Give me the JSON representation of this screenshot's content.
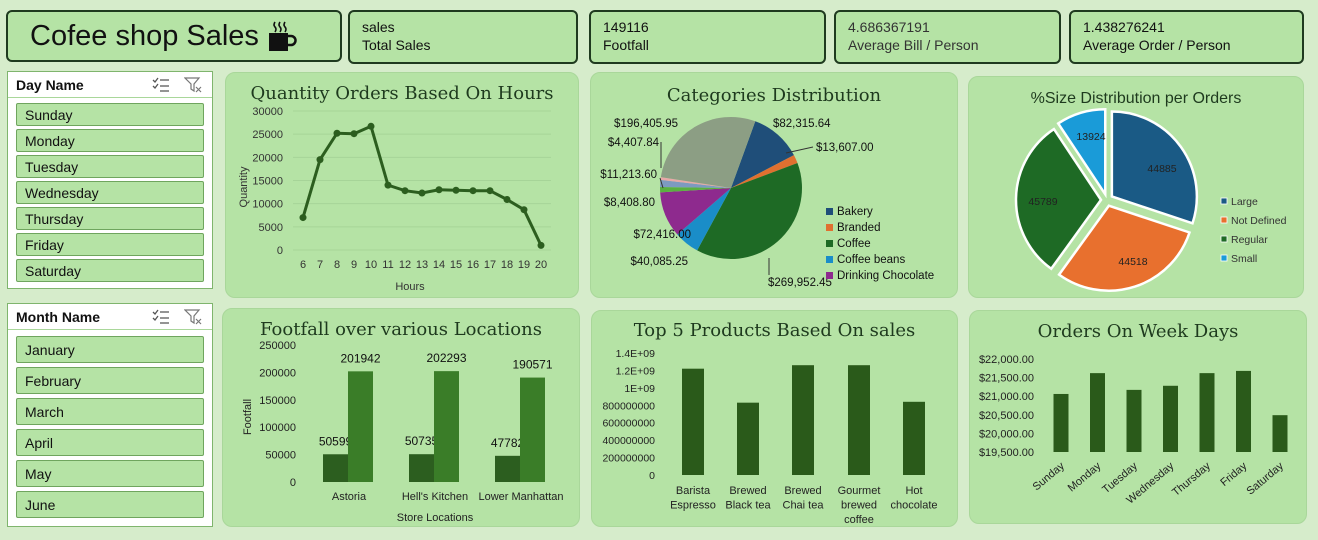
{
  "header": {
    "title": "Cofee shop Sales",
    "icon": "coffee-cup-icon"
  },
  "kpis": [
    {
      "value": "sales",
      "label": "Total Sales"
    },
    {
      "value": "149116",
      "label": "Footfall"
    },
    {
      "value": "4.686367191",
      "label": "Average Bill / Person"
    },
    {
      "value": "1.438276241",
      "label": "Average Order / Person"
    }
  ],
  "slicer_day": {
    "title": "Day Name",
    "items": [
      "Sunday",
      "Monday",
      "Tuesday",
      "Wednesday",
      "Thursday",
      "Friday",
      "Saturday"
    ]
  },
  "slicer_month": {
    "title": "Month Name",
    "items": [
      "January",
      "February",
      "March",
      "April",
      "May",
      "June"
    ]
  },
  "colors": {
    "accent": "#b5e3a5",
    "dark_green": "#2c5e1f",
    "bar_green": "#3a7d28"
  },
  "chart_data": [
    {
      "type": "line",
      "title": "Quantity Orders Based On Hours",
      "xlabel": "Hours",
      "ylabel": "Quantity",
      "x": [
        6,
        7,
        8,
        9,
        10,
        11,
        12,
        13,
        14,
        15,
        16,
        17,
        18,
        19,
        20
      ],
      "values": [
        7000,
        19500,
        25200,
        25100,
        26700,
        14000,
        12800,
        12300,
        13000,
        12900,
        12800,
        12800,
        10900,
        8700,
        1000
      ],
      "yticks": [
        "0",
        "5000",
        "10000",
        "15000",
        "20000",
        "25000",
        "30000"
      ],
      "ylim": [
        0,
        30000
      ]
    },
    {
      "type": "pie",
      "title": "Categories Distribution",
      "slices": [
        {
          "name": "Bakery",
          "value": 82315.64,
          "label": "$82,315.64",
          "color": "#1f4e79"
        },
        {
          "name": "Branded",
          "value": 13607.0,
          "label": "$13,607.00",
          "color": "#e07030"
        },
        {
          "name": "Coffee",
          "value": 269952.45,
          "label": "$269,952.45",
          "color": "#1e6a25"
        },
        {
          "name": "Coffee beans",
          "value": 40085.25,
          "label": "$40,085.25",
          "color": "#1a8dc8"
        },
        {
          "name": "Drinking Chocolate",
          "value": 72416.0,
          "label": "$72,416.00",
          "color": "#8e2a8e"
        },
        {
          "name": "",
          "value": 8408.8,
          "label": "$8,408.80",
          "color": "#5ab040"
        },
        {
          "name": "",
          "value": 11213.6,
          "label": "$11,213.60",
          "color": "#7d9ac0"
        },
        {
          "name": "",
          "value": 4407.84,
          "label": "$4,407.84",
          "color": "#e8a8a8"
        },
        {
          "name": "",
          "value": 196405.95,
          "label": "$196,405.95",
          "color": "#8c9e84"
        }
      ],
      "legend": [
        "Bakery",
        "Branded",
        "Coffee",
        "Coffee beans",
        "Drinking Chocolate"
      ]
    },
    {
      "type": "pie",
      "title": "%Size Distribution per Orders",
      "slices": [
        {
          "name": "Large",
          "value": 44885,
          "label": "44885",
          "color": "#1a5a85"
        },
        {
          "name": "Not Defined",
          "value": 44518,
          "label": "44518",
          "color": "#e8702e"
        },
        {
          "name": "Regular",
          "value": 45789,
          "label": "45789",
          "color": "#1e6a25"
        },
        {
          "name": "Small",
          "value": 13924,
          "label": "13924",
          "color": "#1a9bd8"
        }
      ],
      "legend": [
        "Large",
        "Not Defined",
        "Regular",
        "Small"
      ]
    },
    {
      "type": "bar",
      "title": "Footfall over various Locations",
      "xlabel": "Store Locations",
      "ylabel": "Footfall",
      "categories": [
        "Astoria",
        "Hell's Kitchen",
        "Lower Manhattan"
      ],
      "series": [
        {
          "values": [
            50599,
            50735,
            47782
          ],
          "color": "#2c5e1f"
        },
        {
          "values": [
            201942,
            202293,
            190571
          ],
          "color": "#3a7d28"
        }
      ],
      "yticks": [
        "0",
        "50000",
        "100000",
        "150000",
        "200000",
        "250000"
      ],
      "ylim": [
        0,
        250000
      ]
    },
    {
      "type": "bar",
      "title": "Top 5 Products Based On sales",
      "categories": [
        "Barista Espresso",
        "Brewed Black tea",
        "Brewed Chai tea",
        "Gourmet brewed coffee",
        "Hot chocolate"
      ],
      "category_lines": [
        [
          "Barista",
          "Espresso"
        ],
        [
          "Brewed",
          "Black tea"
        ],
        [
          "Brewed",
          "Chai tea"
        ],
        [
          "Gourmet",
          "brewed",
          "coffee"
        ],
        [
          "Hot",
          "chocolate"
        ]
      ],
      "values": [
        1220000000,
        830000000,
        1260000000,
        1260000000,
        840000000
      ],
      "yticks": [
        "0",
        "200000000",
        "400000000",
        "600000000",
        "800000000",
        "1E+09",
        "1.2E+09",
        "1.4E+09"
      ],
      "ylim": [
        0,
        1400000000
      ]
    },
    {
      "type": "bar",
      "title": "Orders On Week Days",
      "categories": [
        "Sunday",
        "Monday",
        "Tuesday",
        "Wednesday",
        "Thursday",
        "Friday",
        "Saturday"
      ],
      "values": [
        21060,
        21620,
        21170,
        21280,
        21620,
        21680,
        20490
      ],
      "yticks": [
        "$19,500.00",
        "$20,000.00",
        "$20,500.00",
        "$21,000.00",
        "$21,500.00",
        "$22,000.00"
      ],
      "ylim": [
        19500,
        22000
      ]
    }
  ]
}
